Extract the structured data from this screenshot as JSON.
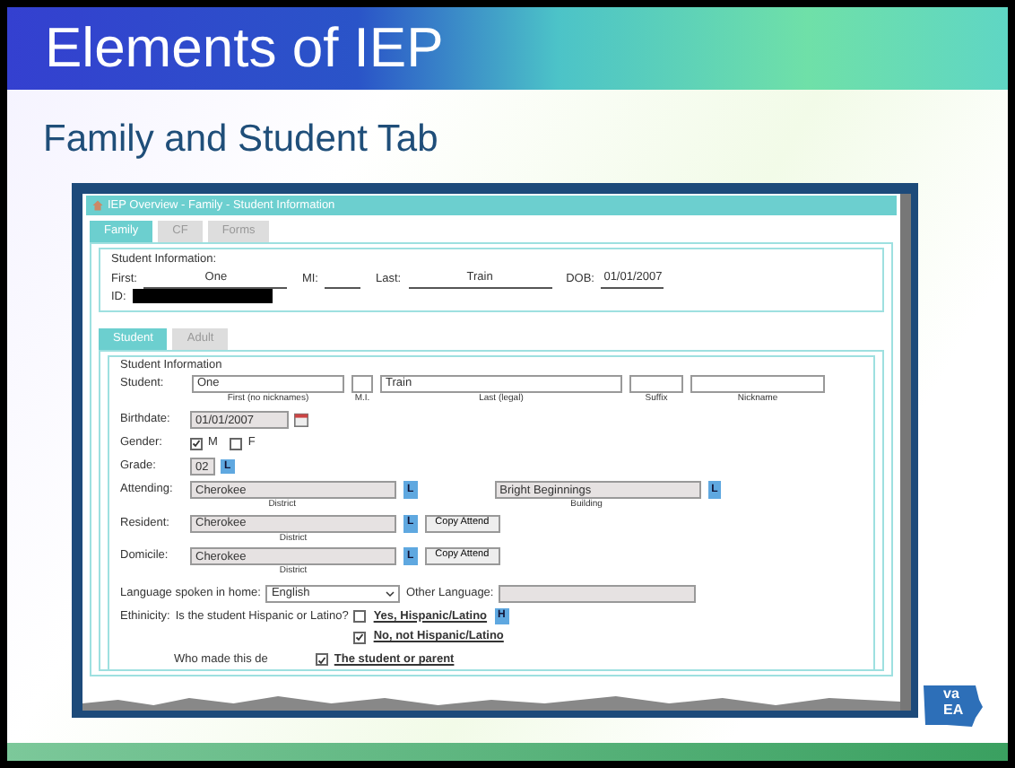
{
  "slide": {
    "title": "Elements of IEP",
    "subtitle": "Family and Student Tab"
  },
  "window": {
    "title": "IEP Overview - Family - Student Information",
    "tabs": [
      {
        "label": "Family",
        "selected": true
      },
      {
        "label": "CF",
        "selected": false
      },
      {
        "label": "Forms",
        "selected": false
      }
    ],
    "student_information": {
      "legend": "Student Information:",
      "fields": [
        {
          "label": "First:",
          "value": "One"
        },
        {
          "label": "MI:"
        },
        {
          "label": "Last:",
          "value": "Train"
        },
        {
          "label": "DOB:",
          "value": "01/01/2007"
        }
      ],
      "id": {
        "label": "ID:",
        "redacted": true
      }
    },
    "subtabs": [
      {
        "label": "Student",
        "selected": true
      },
      {
        "label": "Adult",
        "selected": false
      }
    ],
    "section": {
      "legend": "Student Information",
      "student_row": {
        "label": "Student:",
        "fields": [
          {
            "value": "One",
            "caption": "First (no nicknames)"
          },
          {
            "caption": "M.I."
          },
          {
            "value": "Train",
            "caption": "Last (legal)"
          },
          {
            "caption": "Suffix"
          },
          {
            "caption": "Nickname"
          }
        ]
      },
      "birthdate": {
        "label": "Birthdate:",
        "value": "01/01/2007"
      },
      "gender": {
        "label": "Gender:",
        "options": [
          {
            "label": "M",
            "checked": true
          },
          {
            "label": "F",
            "checked": false
          }
        ]
      },
      "grade": {
        "label": "Grade:",
        "value": "02",
        "lookup": "L"
      },
      "attending": {
        "label": "Attending:",
        "district": {
          "value": "Cherokee",
          "caption": "District",
          "lookup": "L"
        },
        "building": {
          "value": "Bright Beginnings",
          "caption": "Building",
          "lookup": "L"
        }
      },
      "places": [
        {
          "label": "Resident:",
          "value": "Cherokee",
          "lookup": "L",
          "button": "Copy Attend",
          "caption": "District"
        },
        {
          "label": "Domicile:",
          "value": "Cherokee",
          "lookup": "L",
          "button": "Copy Attend",
          "caption": "District"
        }
      ],
      "language": {
        "label": "Language spoken in home:",
        "value": "English",
        "other_label": "Other Language:"
      },
      "ethnicity": {
        "label": "Ethinicity:",
        "question": "Is the student Hispanic or Latino?",
        "options": [
          {
            "label": "Yes, Hispanic/Latino",
            "checked": false,
            "badge": "H"
          },
          {
            "label": "No, not Hispanic/Latino",
            "checked": true
          }
        ]
      },
      "determination": {
        "label": "Who made this de",
        "option": {
          "label": "The student or parent",
          "checked": true
        }
      }
    }
  },
  "logo": {
    "lines": [
      "va",
      "EA"
    ]
  }
}
